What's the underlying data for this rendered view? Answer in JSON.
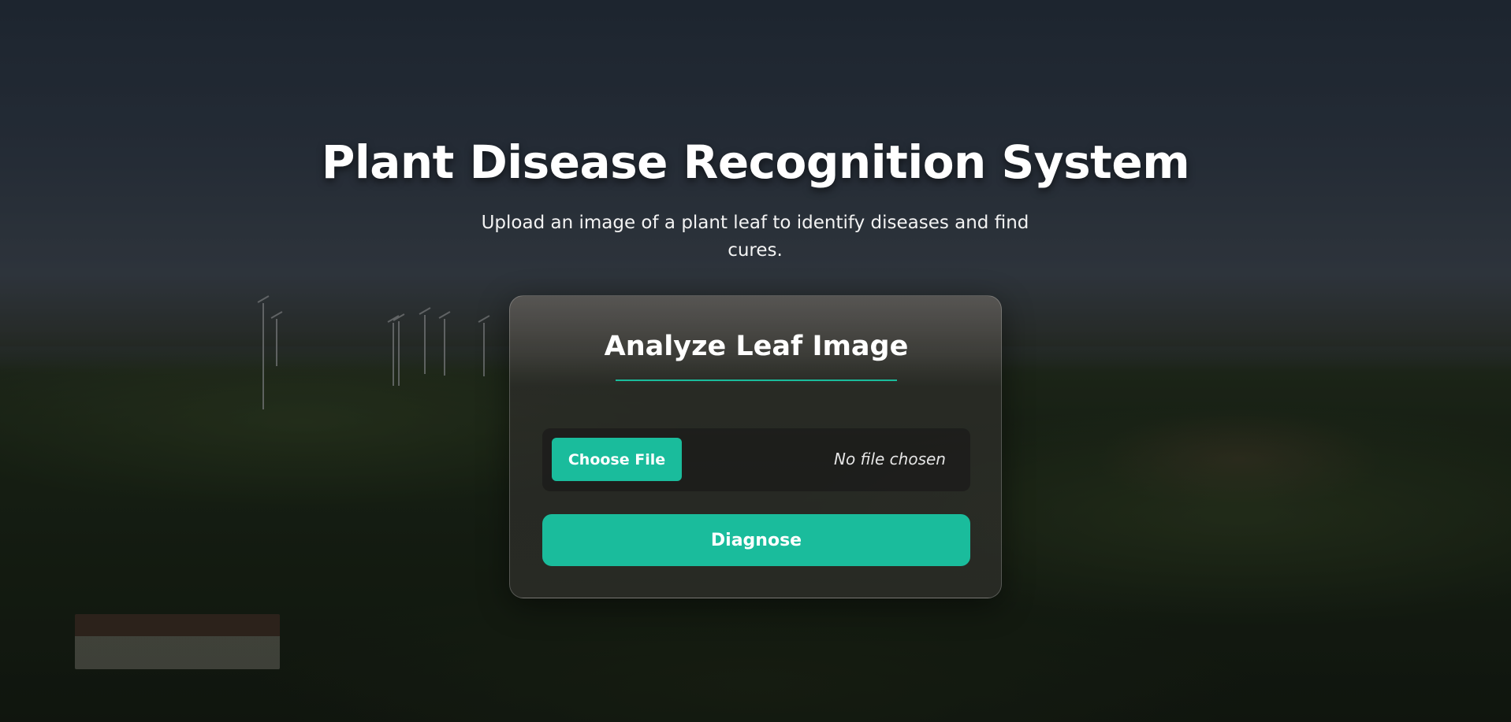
{
  "hero": {
    "title": "Plant Disease Recognition System",
    "subtitle": "Upload an image of a plant leaf to identify diseases and find cures."
  },
  "card": {
    "title": "Analyze Leaf Image",
    "file_input": {
      "button_label": "Choose File",
      "status": "No file chosen"
    },
    "submit_label": "Diagnose"
  },
  "colors": {
    "accent": "#1abc9c"
  }
}
